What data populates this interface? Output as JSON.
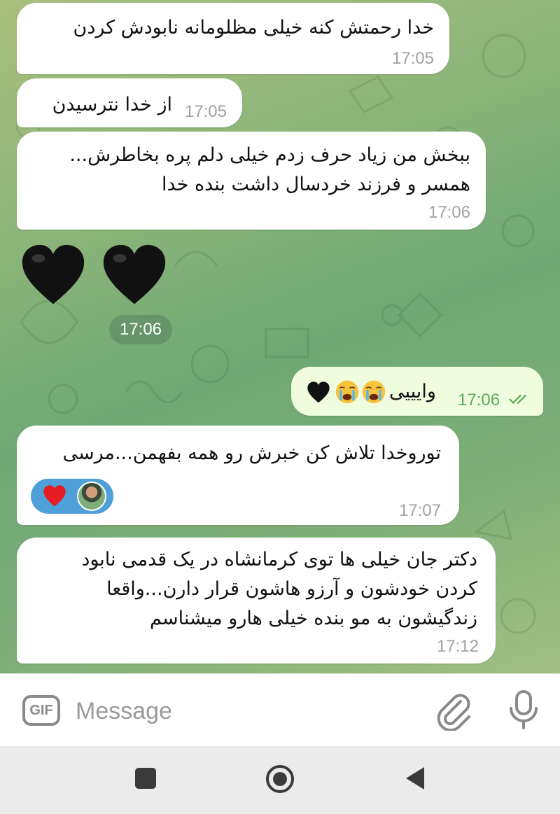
{
  "messages": [
    {
      "direction": "in",
      "text": "خدا رحمتش کنه خیلی مظلومانه نابودش کردن",
      "time": "17:05"
    },
    {
      "direction": "in",
      "text": "از خدا نترسیدن",
      "time": "17:05"
    },
    {
      "direction": "in",
      "lines": [
        "ببخش من زیاد حرف زدم خیلی دلم پره بخاطرش...",
        "همسر و فرزند خردسال داشت بنده خدا"
      ],
      "time": "17:06"
    },
    {
      "direction": "in",
      "sticker": "black-heart-emoji x2",
      "time": "17:06"
    },
    {
      "direction": "out",
      "text": "وایییی",
      "emoji": [
        "loudly-crying-face",
        "loudly-crying-face",
        "black-heart"
      ],
      "time": "17:06",
      "status": "read-double-check"
    },
    {
      "direction": "in",
      "text": "توروخدا تلاش کن خبرش رو همه بفهمن...مرسی",
      "reactions": [
        "red-heart",
        "user-avatar"
      ],
      "time": "17:07"
    },
    {
      "direction": "in",
      "lines": [
        "دکتر جان خیلی ها توی کرمانشاه در یک قدمی نابود",
        "کردن خودشون و آرزو هاشون قرار دارن...واقعا",
        "زندگیشون به مو بنده خیلی هارو میشناسم"
      ],
      "time": "17:12"
    }
  ],
  "input": {
    "gif_label": "GIF",
    "placeholder": "Message",
    "value": ""
  },
  "icons": {
    "attach": "paperclip-icon",
    "mic": "microphone-icon",
    "nav": [
      "recent-apps-icon",
      "home-icon",
      "back-icon"
    ]
  },
  "colors": {
    "incoming_bubble": "#ffffff",
    "outgoing_bubble": "#effdde",
    "outgoing_time": "#5ea95a",
    "incoming_time": "#a2a2a2",
    "reaction_bg": "#4f9fd8",
    "wallpaper_start": "#a9bf7c",
    "wallpaper_mid": "#6fa874"
  }
}
